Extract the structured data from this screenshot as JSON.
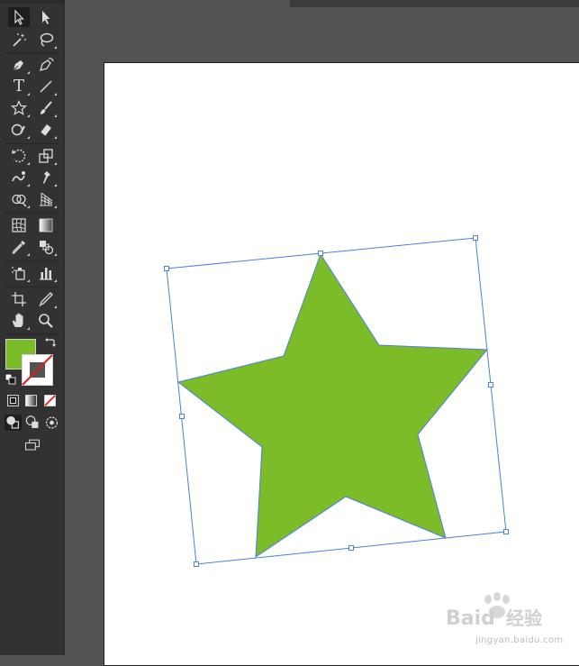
{
  "app": "Adobe Illustrator",
  "colors": {
    "fill": "#7bbc28",
    "selection": "#4b7fe0",
    "ui_dark": "#323232",
    "pasteboard": "#535353"
  },
  "tools": [
    {
      "id": "selection",
      "icon": "selection-arrow-icon",
      "active": true
    },
    {
      "id": "direct-selection",
      "icon": "direct-selection-arrow-icon"
    },
    {
      "id": "magic-wand",
      "icon": "magic-wand-icon"
    },
    {
      "id": "lasso",
      "icon": "lasso-icon"
    },
    {
      "id": "pen",
      "icon": "pen-icon"
    },
    {
      "id": "curvature",
      "icon": "curvature-pen-icon"
    },
    {
      "id": "type",
      "icon": "type-icon",
      "glyph": "T"
    },
    {
      "id": "line",
      "icon": "line-segment-icon"
    },
    {
      "id": "star",
      "icon": "star-icon",
      "glyph": "☆"
    },
    {
      "id": "paintbrush",
      "icon": "paintbrush-icon"
    },
    {
      "id": "shaper",
      "icon": "shaper-icon"
    },
    {
      "id": "eraser",
      "icon": "eraser-icon"
    },
    {
      "id": "rotate",
      "icon": "rotate-icon"
    },
    {
      "id": "scale",
      "icon": "scale-icon"
    },
    {
      "id": "warp",
      "icon": "warp-icon"
    },
    {
      "id": "puppet-warp",
      "icon": "puppet-warp-icon"
    },
    {
      "id": "shape-builder",
      "icon": "shape-builder-icon"
    },
    {
      "id": "perspective-grid",
      "icon": "perspective-grid-icon"
    },
    {
      "id": "mesh",
      "icon": "mesh-icon"
    },
    {
      "id": "gradient",
      "icon": "gradient-icon"
    },
    {
      "id": "eyedropper",
      "icon": "eyedropper-icon"
    },
    {
      "id": "blend",
      "icon": "blend-icon"
    },
    {
      "id": "symbol-sprayer",
      "icon": "symbol-sprayer-icon"
    },
    {
      "id": "column-graph",
      "icon": "column-graph-icon"
    },
    {
      "id": "artboard",
      "icon": "artboard-icon"
    },
    {
      "id": "slice",
      "icon": "slice-icon"
    },
    {
      "id": "hand",
      "icon": "hand-icon"
    },
    {
      "id": "zoom",
      "icon": "zoom-icon"
    }
  ],
  "watermark": {
    "logo_text": "Baid",
    "logo_cn": "经验",
    "domain": "jingyan.baidu.com"
  }
}
